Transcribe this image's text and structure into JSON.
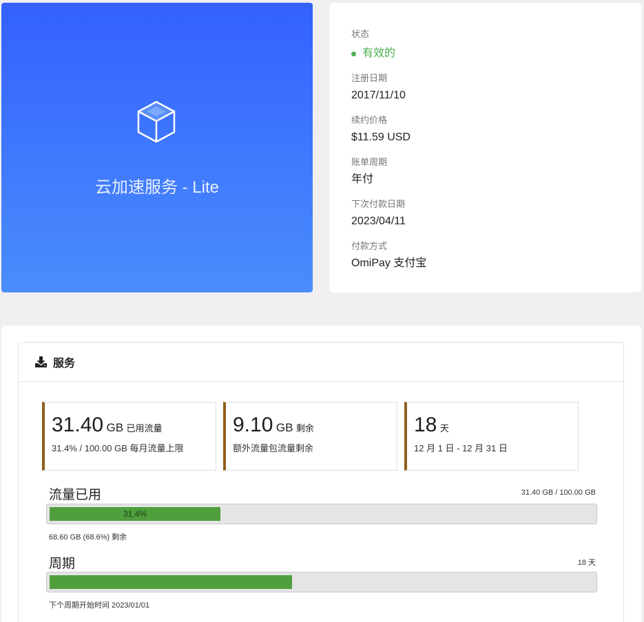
{
  "hero": {
    "product_name": "云加速服务 - Lite",
    "icon": "cube-icon"
  },
  "info": {
    "status_label": "状态",
    "status_value": "有效的",
    "status_color": "#4caf50",
    "reg_date_label": "注册日期",
    "reg_date_value": "2017/11/10",
    "renew_price_label": "续约价格",
    "renew_price_value": "$11.59 USD",
    "billing_cycle_label": "账单周期",
    "billing_cycle_value": "年付",
    "next_due_label": "下次付款日期",
    "next_due_value": "2023/04/11",
    "payment_method_label": "付款方式",
    "payment_method_value": "OmiPay 支付宝"
  },
  "service": {
    "header_icon": "download-icon",
    "header_title": "服务",
    "stats": [
      {
        "big": "31.40",
        "unit": "GB",
        "label": "已用流量",
        "sub": "31.4% / 100.00 GB 每月流量上限"
      },
      {
        "big": "9.10",
        "unit": "GB",
        "label": "剩余",
        "sub": "额外流量包流量剩余"
      },
      {
        "big": "18",
        "unit": "",
        "label": "天",
        "sub": "12 月 1 日 - 12 月 31 日"
      }
    ],
    "traffic": {
      "title": "流量已用",
      "right": "31.40 GB / 100.00 GB",
      "fill_label": "31.4%",
      "fill_percent": 31.4,
      "note": "68.60 GB (68.6%) 剩余"
    },
    "cycle": {
      "title": "周期",
      "right": "18 天",
      "fill_percent": 44.6,
      "note": "下个周期开始时间 2023/01/01"
    },
    "accent_color": "#8f5f1d",
    "bar_color": "#4f9f3d"
  }
}
